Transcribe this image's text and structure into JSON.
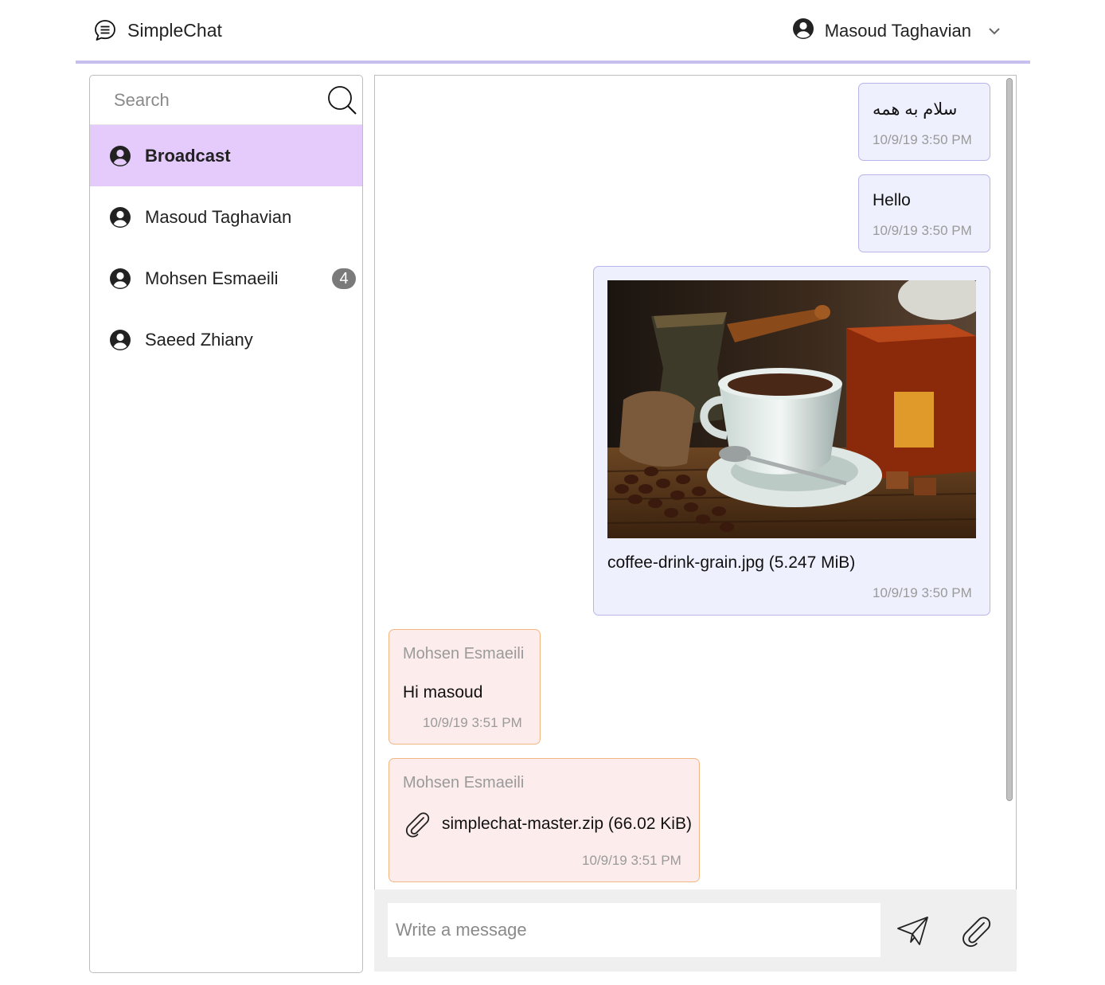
{
  "header": {
    "app_name": "SimpleChat",
    "app_icon": "chat-bubble-icon",
    "current_user": "Masoud Taghavian",
    "user_icon": "user-circle-icon",
    "dropdown_icon": "chevron-down-icon"
  },
  "sidebar": {
    "search_placeholder": "Search",
    "search_icon": "search-icon",
    "contacts": [
      {
        "name": "Broadcast",
        "active": true
      },
      {
        "name": "Masoud Taghavian"
      },
      {
        "name": "Mohsen Esmaeili",
        "unread": "4"
      },
      {
        "name": "Saeed Zhiany"
      }
    ]
  },
  "messages": [
    {
      "direction": "out",
      "text": "سلام به همه",
      "time": "10/9/19 3:50 PM"
    },
    {
      "direction": "out",
      "text": "Hello",
      "time": "10/9/19 3:50 PM"
    },
    {
      "direction": "out",
      "type": "image",
      "text": "coffee-drink-grain.jpg (5.247 MiB)",
      "time": "10/9/19 3:50 PM"
    },
    {
      "direction": "in",
      "sender": "Mohsen Esmaeili",
      "text": "Hi masoud",
      "time": "10/9/19 3:51 PM"
    },
    {
      "direction": "in",
      "sender": "Mohsen Esmaeili",
      "type": "file",
      "text": "simplechat-master.zip (66.02 KiB)",
      "time": "10/9/19 3:51 PM",
      "icon": "paperclip-icon"
    }
  ],
  "compose": {
    "placeholder": "Write a message",
    "send_icon": "send-icon",
    "attach_icon": "paperclip-icon"
  },
  "colors": {
    "accent_border": "#c7c0ee",
    "active_contact": "#e4cbfb",
    "outgoing_bg": "#eff0fd",
    "outgoing_border": "#b7b4ec",
    "incoming_bg": "#fdecec",
    "incoming_border": "#f3b783",
    "badge": "#7a7a7a"
  }
}
